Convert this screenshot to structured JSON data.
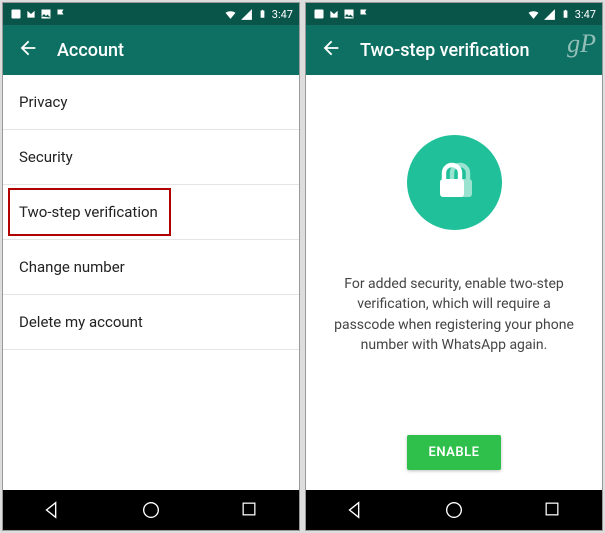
{
  "statusbar": {
    "time": "3:47"
  },
  "left": {
    "title": "Account",
    "items": [
      {
        "label": "Privacy"
      },
      {
        "label": "Security"
      },
      {
        "label": "Two-step verification",
        "highlighted": true
      },
      {
        "label": "Change number"
      },
      {
        "label": "Delete my account"
      }
    ]
  },
  "right": {
    "title": "Two-step verification",
    "watermark": "gP",
    "description": "For added security, enable two-step verification, which will require a passcode when registering your phone number with WhatsApp again.",
    "enable_label": "ENABLE"
  },
  "colors": {
    "statusbar": "#0a554a",
    "appbar": "#0d7062",
    "accent": "#20c19a",
    "button": "#2fc04b",
    "highlight": "#b10000"
  }
}
